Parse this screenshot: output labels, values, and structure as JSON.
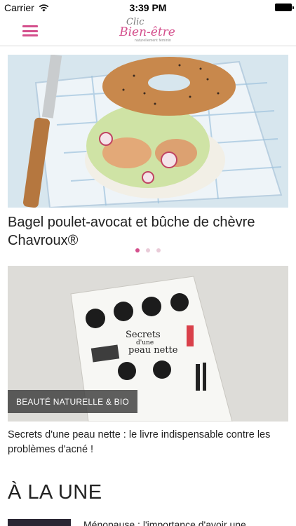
{
  "status_bar": {
    "carrier": "Carrier",
    "time": "3:39 PM"
  },
  "nav": {
    "logo_top": "Clic",
    "logo_main": "Bien-être",
    "logo_sub": "naturellement féminin"
  },
  "carousel": {
    "title": "Bagel poulet-avocat et bûche de chèvre Chavroux®",
    "page_count": 3,
    "active_page": 1
  },
  "article": {
    "category": "BEAUTÉ NATURELLE & BIO",
    "title": "Secrets d'une peau nette : le livre indispensable contre les problèmes d'acné !",
    "book_title_1": "Secrets",
    "book_title_2": "d'une",
    "book_title_3": "peau nette"
  },
  "section": {
    "title": "À LA UNE",
    "next_item_title": "Ménopause : l'importance d'avoir une"
  },
  "colors": {
    "accent": "#d44f8c"
  }
}
